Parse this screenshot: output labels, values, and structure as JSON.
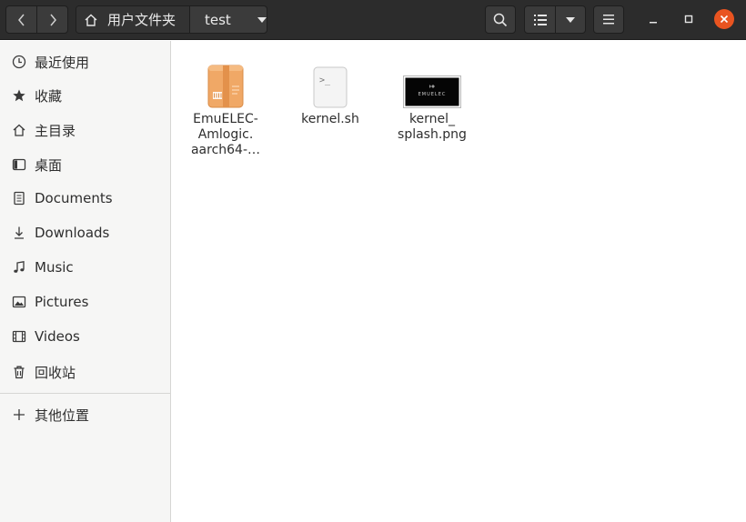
{
  "window": {
    "title": "test"
  },
  "header": {
    "breadcrumb": {
      "home_label": "用户文件夹",
      "current_label": "test"
    },
    "icons": {
      "back": "chevron-left-icon",
      "forward": "chevron-right-icon",
      "home": "home-icon",
      "search": "search-icon",
      "list_view": "list-view-icon",
      "view_options": "chevron-down-icon",
      "menu": "hamburger-menu-icon",
      "minimize": "minimize-icon",
      "maximize": "maximize-icon",
      "close": "close-icon"
    },
    "colors": {
      "headerbar": "#2c2c2c",
      "close_button": "#e95420"
    }
  },
  "sidebar": {
    "items": [
      {
        "label": "最近使用",
        "icon": "clock-icon"
      },
      {
        "label": "收藏",
        "icon": "star-icon"
      },
      {
        "label": "主目录",
        "icon": "home-icon"
      },
      {
        "label": "桌面",
        "icon": "desktop-icon"
      },
      {
        "label": "Documents",
        "icon": "document-icon"
      },
      {
        "label": "Downloads",
        "icon": "download-icon"
      },
      {
        "label": "Music",
        "icon": "music-icon"
      },
      {
        "label": "Pictures",
        "icon": "picture-icon"
      },
      {
        "label": "Videos",
        "icon": "video-icon"
      },
      {
        "label": "回收站",
        "icon": "trash-icon"
      }
    ],
    "other_locations": {
      "label": "其他位置",
      "icon": "plus-icon"
    }
  },
  "files": [
    {
      "name_lines": [
        "EmuELEC-",
        "Amlogic.",
        "aarch64-…"
      ],
      "icon": "archive-icon",
      "color": "#f0a866"
    },
    {
      "name_lines": [
        "kernel.sh"
      ],
      "icon": "script-icon",
      "thumb_text": ">_"
    },
    {
      "name_lines": [
        "kernel_",
        "splash.png"
      ],
      "icon": "image-thumbnail",
      "thumb_text": "EMUELEC"
    }
  ]
}
